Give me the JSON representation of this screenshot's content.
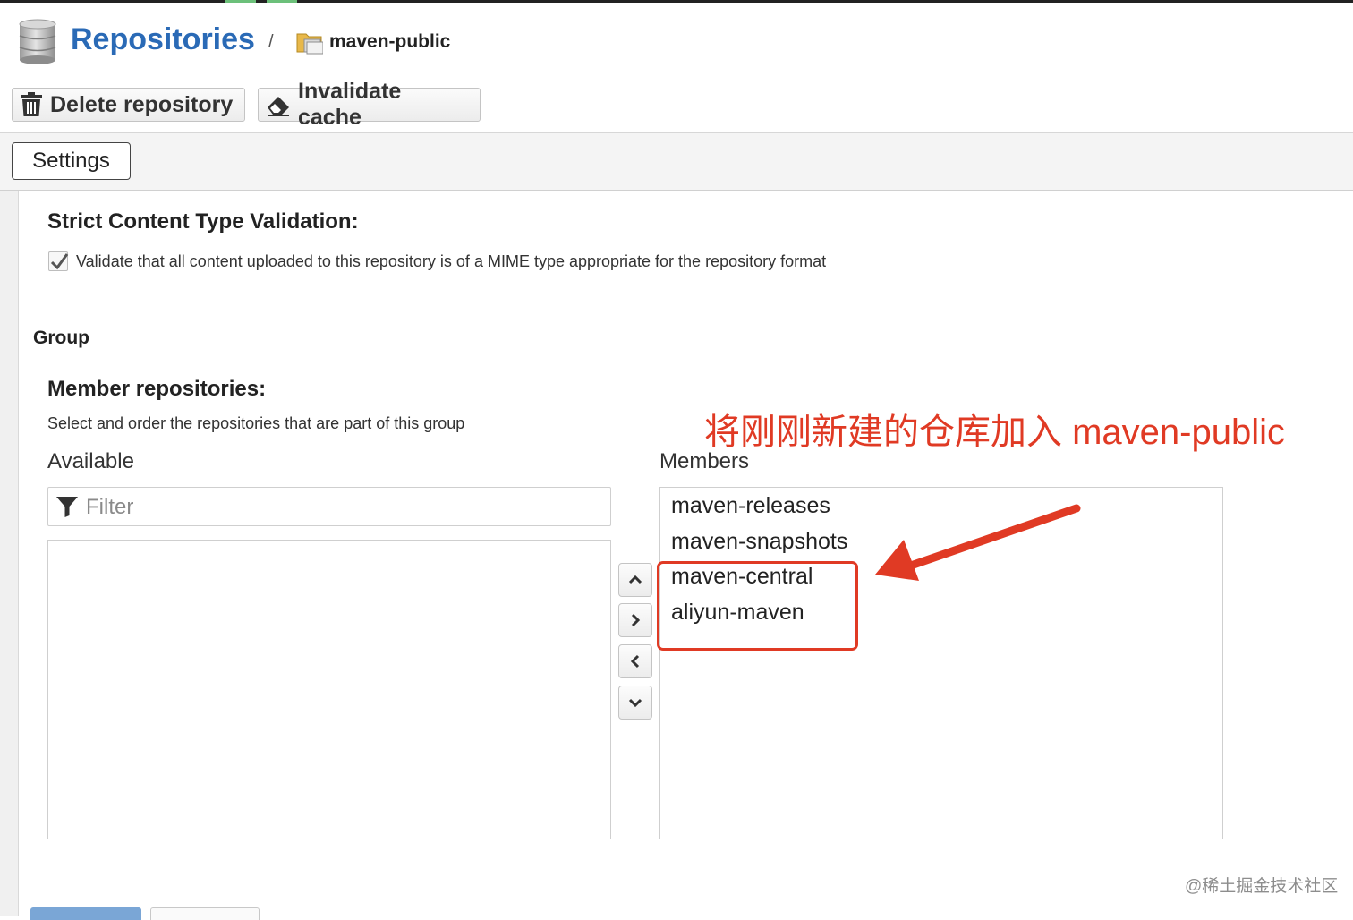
{
  "breadcrumb": {
    "root": "Repositories",
    "separator": "/",
    "current": "maven-public"
  },
  "toolbar": {
    "delete_label": "Delete repository",
    "invalidate_label": "Invalidate cache"
  },
  "tabs": {
    "settings_label": "Settings"
  },
  "strict_validation": {
    "heading": "Strict Content Type Validation:",
    "checkbox_label": "Validate that all content uploaded to this repository is of a MIME type appropriate for the repository format",
    "checked": true
  },
  "group": {
    "heading": "Group",
    "member_heading": "Member repositories:",
    "member_help": "Select and order the repositories that are part of this group",
    "available_label": "Available",
    "members_label": "Members",
    "filter_placeholder": "Filter",
    "available_items": [],
    "members": [
      "maven-releases",
      "maven-snapshots",
      "maven-central",
      "aliyun-maven"
    ]
  },
  "annotation": {
    "text": "将刚刚新建的仓库加入 maven-public",
    "color": "#e03a24"
  },
  "watermark": "@稀土掘金技术社区",
  "colors": {
    "link": "#2a6ab6",
    "annotation": "#e03a24"
  }
}
